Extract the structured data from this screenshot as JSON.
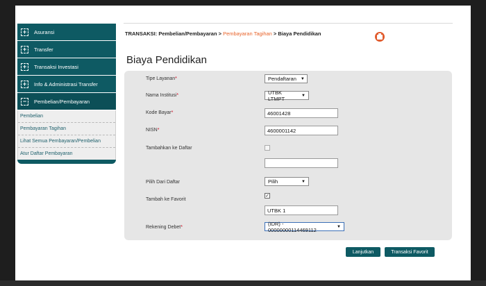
{
  "sidebar": {
    "items": [
      {
        "label": "Asuransi",
        "icon": "+"
      },
      {
        "label": "Transfer",
        "icon": "+"
      },
      {
        "label": "Transaksi Investasi",
        "icon": "+"
      },
      {
        "label": "Info & Administrasi Transfer",
        "icon": "+"
      },
      {
        "label": "Pembelian/Pembayaran",
        "icon": "−"
      }
    ],
    "subitems": [
      "Pembelian",
      "Pembayaran Tagihan",
      "Lihat Semua Pembayaran/Pembelian",
      "Atur Daftar Pembayaran"
    ]
  },
  "breadcrumb": {
    "prefix": "TRANSAKSI: Pembelian/Pembayaran > ",
    "link": "Pembayaran Tagihan",
    "suffix": " > Biaya Pendidikan"
  },
  "page": {
    "title": "Biaya Pendidikan"
  },
  "form": {
    "tipe_layanan": {
      "label": "Tipe Layanan",
      "value": "Pendaftaran"
    },
    "nama_institusi": {
      "label": "Nama Institusi",
      "value": "UTBK LTMPT"
    },
    "kode_bayar": {
      "label": "Kode Bayar",
      "value": "46001428"
    },
    "nisn": {
      "label": "NISN",
      "value": "4600001142"
    },
    "tambahkan_ke_daftar": {
      "label": "Tambahkan ke Daftar",
      "checked": false,
      "text": ""
    },
    "pilih_dari_daftar": {
      "label": "Pilih Dari Daftar",
      "value": "Pilih"
    },
    "tambah_ke_favorit": {
      "label": "Tambah ke Favorit",
      "checked": true,
      "text": "UTBK 1"
    },
    "rekening_debet": {
      "label": "Rekening Debet",
      "value": "(IDR) - 00000000114469112"
    },
    "required_mark": "*"
  },
  "buttons": {
    "lanjutkan": "Lanjutkan",
    "transaksi_favorit": "Transaksi Favorit"
  },
  "colors": {
    "brand": "#0e5a63",
    "accent": "#e8632a",
    "required": "#d0021b"
  }
}
